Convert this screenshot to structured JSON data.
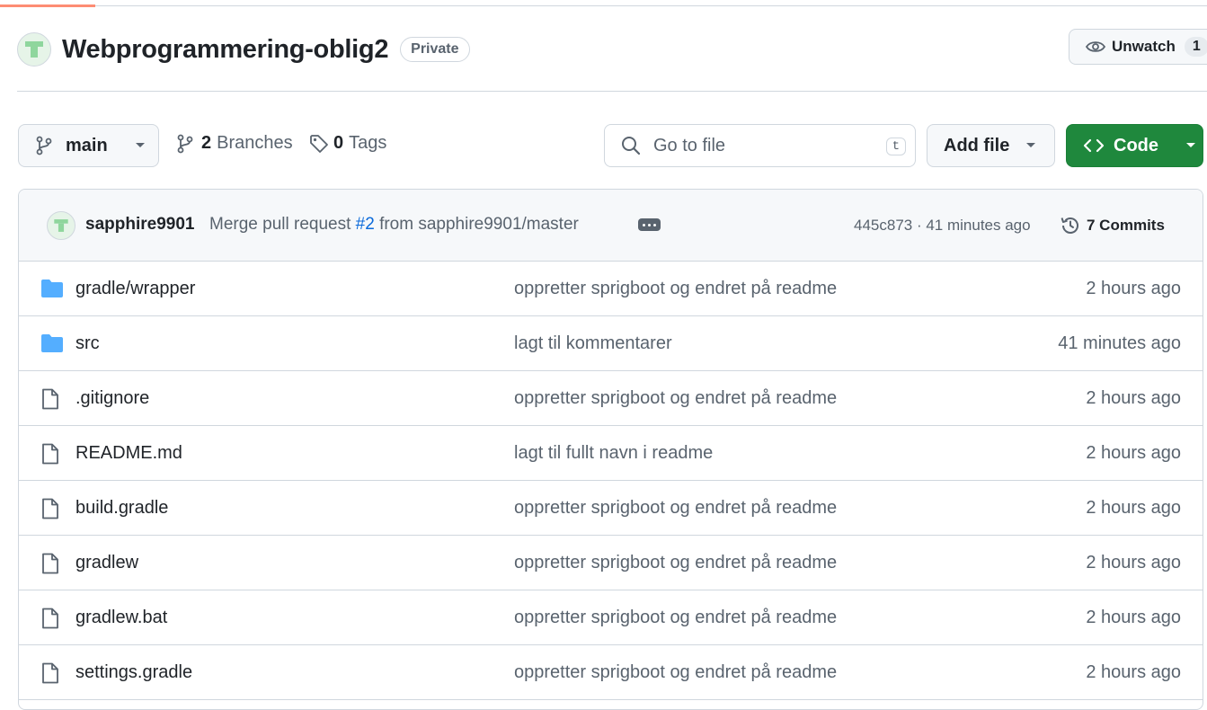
{
  "repo": {
    "name": "Webprogrammering-oblig2",
    "visibility": "Private",
    "watch_label": "Unwatch",
    "watch_count": "1"
  },
  "toolbar": {
    "branch": "main",
    "branches_count": "2",
    "branches_label": "Branches",
    "tags_count": "0",
    "tags_label": "Tags",
    "search_placeholder": "Go to file",
    "search_shortcut": "t",
    "add_file_label": "Add file",
    "code_label": "Code"
  },
  "latest_commit": {
    "author": "sapphire9901",
    "message_prefix": "Merge pull request ",
    "pr_link": "#2",
    "message_suffix": " from sapphire9901/master",
    "sha_time": "445c873 · 41 minutes ago",
    "commits_label": "7 Commits"
  },
  "files": [
    {
      "name": "gradle/wrapper",
      "type": "folder",
      "message": "oppretter sprigboot og endret på readme",
      "age": "2 hours ago"
    },
    {
      "name": "src",
      "type": "folder",
      "message": "lagt til kommentarer",
      "age": "41 minutes ago"
    },
    {
      "name": ".gitignore",
      "type": "file",
      "message": "oppretter sprigboot og endret på readme",
      "age": "2 hours ago"
    },
    {
      "name": "README.md",
      "type": "file",
      "message": "lagt til fullt navn i readme",
      "age": "2 hours ago"
    },
    {
      "name": "build.gradle",
      "type": "file",
      "message": "oppretter sprigboot og endret på readme",
      "age": "2 hours ago"
    },
    {
      "name": "gradlew",
      "type": "file",
      "message": "oppretter sprigboot og endret på readme",
      "age": "2 hours ago"
    },
    {
      "name": "gradlew.bat",
      "type": "file",
      "message": "oppretter sprigboot og endret på readme",
      "age": "2 hours ago"
    },
    {
      "name": "settings.gradle",
      "type": "file",
      "message": "oppretter sprigboot og endret på readme",
      "age": "2 hours ago"
    }
  ],
  "colors": {
    "accent_green": "#1f883d",
    "link_blue": "#0969da",
    "folder_blue": "#54aeff",
    "muted_text": "#59636e"
  }
}
